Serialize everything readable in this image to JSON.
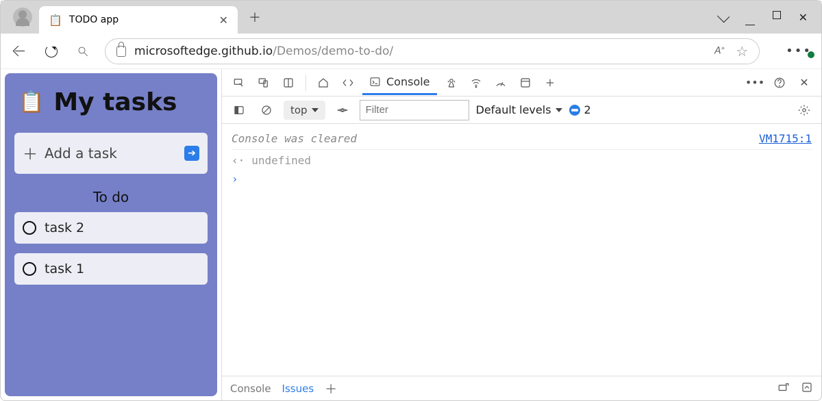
{
  "browser": {
    "tab": {
      "favicon": "📋",
      "title": "TODO app"
    },
    "url_dark": "microsoftedge.github.io",
    "url_rest": "/Demos/demo-to-do/",
    "read_aloud_label": "A",
    "read_aloud_sup": "»"
  },
  "todo": {
    "title": "My tasks",
    "add_placeholder": "Add a task",
    "section": "To do",
    "tasks": [
      "task 2",
      "task 1"
    ]
  },
  "devtools": {
    "console_tab": "Console",
    "context": "top",
    "filter_placeholder": "Filter",
    "levels_label": "Default levels",
    "issues_count": "2",
    "cleared_msg": "Console was cleared",
    "cleared_source": "VM1715:1",
    "undefined_text": "undefined",
    "drawer": {
      "console": "Console",
      "issues": "Issues"
    }
  }
}
